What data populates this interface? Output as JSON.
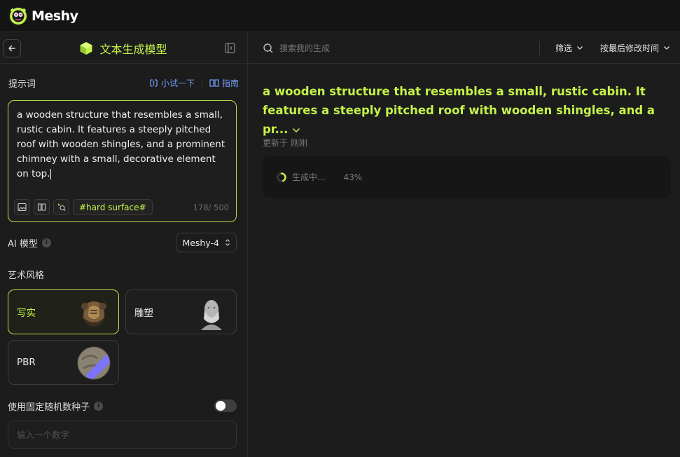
{
  "app": {
    "brand": "Meshy"
  },
  "left_panel": {
    "title": "文本生成模型",
    "prompt": {
      "label": "提示词",
      "try_link": "小试一下",
      "guide_link": "指南",
      "text": "a wooden structure that resembles a small, rustic cabin. It features a steeply pitched roof with wooden shingles, and a prominent chimney with a small, decorative element on top.",
      "tag": "#hard surface#",
      "count": "178/ 500"
    },
    "model": {
      "label": "AI 模型",
      "value": "Meshy-4"
    },
    "art_style": {
      "label": "艺术风格",
      "options": [
        {
          "name": "写实",
          "selected": true,
          "icon": "armor-thumb"
        },
        {
          "name": "雕塑",
          "selected": false,
          "icon": "bust-thumb"
        },
        {
          "name": "PBR",
          "selected": false,
          "icon": "sphere-thumb"
        }
      ]
    },
    "seed": {
      "label": "使用固定随机数种子",
      "enabled": false,
      "placeholder": "输入一个数字"
    }
  },
  "right_panel": {
    "search_placeholder": "搜索我的生成",
    "filter_label": "筛选",
    "sort_label": "按最后修改时间",
    "generation": {
      "title": "a wooden structure that resembles a small, rustic cabin. It features a steeply pitched roof with wooden shingles, and a pr...",
      "updated": "更新于 刚刚",
      "status": "生成中...",
      "progress": "43%",
      "progress_fraction": 0.43
    }
  },
  "colors": {
    "accent": "#c4f24a",
    "link": "#6f9bf5",
    "background": "#1c1c1c"
  }
}
